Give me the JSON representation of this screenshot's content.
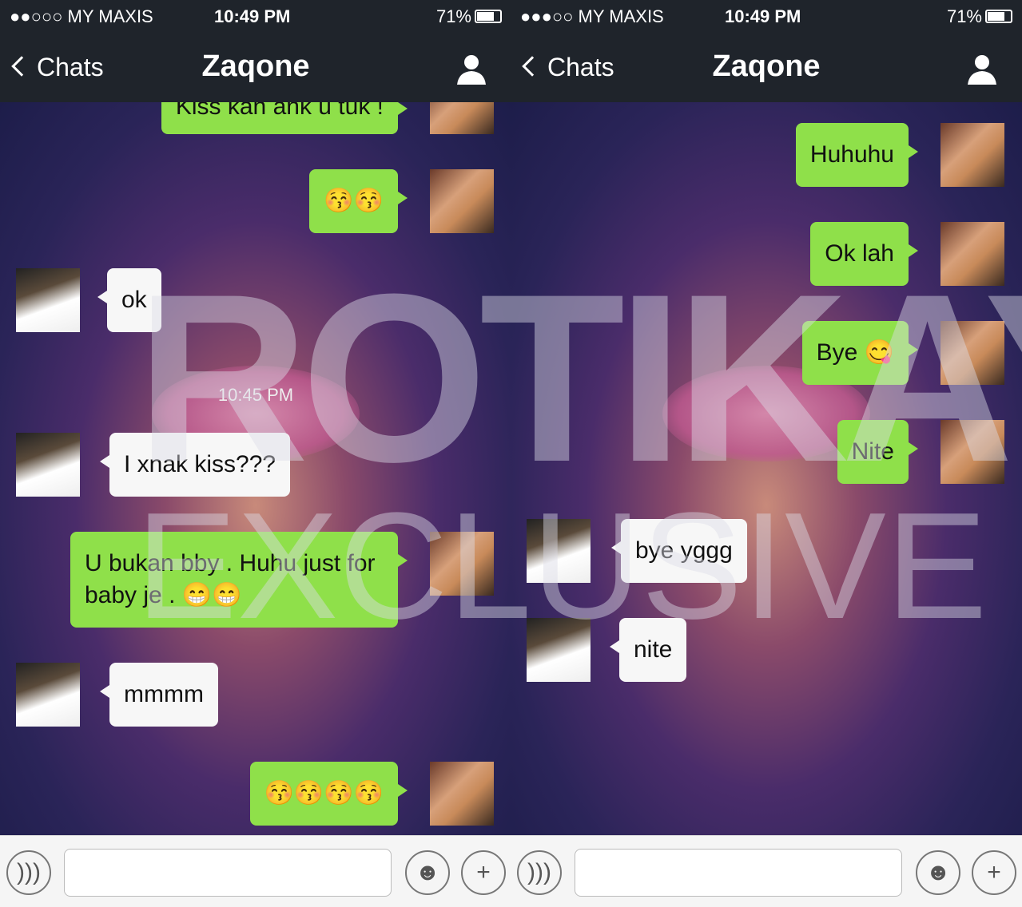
{
  "status": {
    "carrier": "●●○○○ MY MAXIS",
    "carrier2": "●●●○○ MY MAXIS",
    "time": "10:49 PM",
    "battery": "71%",
    "battery_level": 0.71
  },
  "nav": {
    "back": "Chats",
    "title": "Zaqone"
  },
  "watermark": {
    "line1": "ROTIKAYA",
    "line2": "EXCLUSIVE"
  },
  "left": {
    "m1": "Kiss kan ank u tuk !",
    "m2": "😚😚",
    "m3": "ok",
    "timestamp": "10:45 PM",
    "m4": "I xnak kiss???",
    "m5": "U bukan bby . Huhu just for baby je . 😁😁",
    "m6": "mmmm",
    "m7": "😚😚😚😚"
  },
  "right": {
    "m1": "Huhuhu",
    "m2": "Ok lah",
    "m3": "Bye 😋",
    "m4": "Nite",
    "m5": "bye yggg",
    "m6": "nite"
  },
  "colors": {
    "sent": "#8fe04a",
    "received": "#f7f7f7",
    "bar": "#1f242b"
  }
}
